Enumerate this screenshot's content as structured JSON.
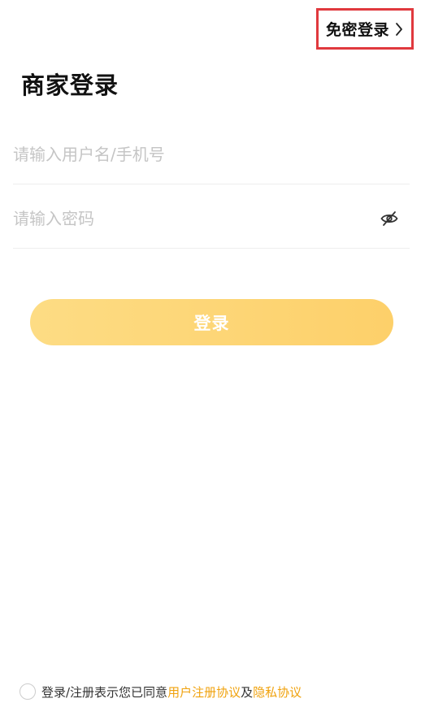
{
  "header": {
    "sms_login_label": "免密登录"
  },
  "page": {
    "title": "商家登录"
  },
  "form": {
    "username": {
      "value": "",
      "placeholder": "请输入用户名/手机号"
    },
    "password": {
      "value": "",
      "placeholder": "请输入密码"
    },
    "submit_label": "登录"
  },
  "agreement": {
    "prefix": "登录/注册表示您已同意",
    "user_agreement": "用户注册协议",
    "conjunction": "及",
    "privacy_agreement": "隐私协议",
    "checked": false
  },
  "colors": {
    "accent": "#fdd06a",
    "link": "#f0a20d",
    "highlight_border": "#e0393e"
  },
  "icons": {
    "chevron": "chevron-right-icon",
    "password_toggle": "eye-off-icon"
  }
}
